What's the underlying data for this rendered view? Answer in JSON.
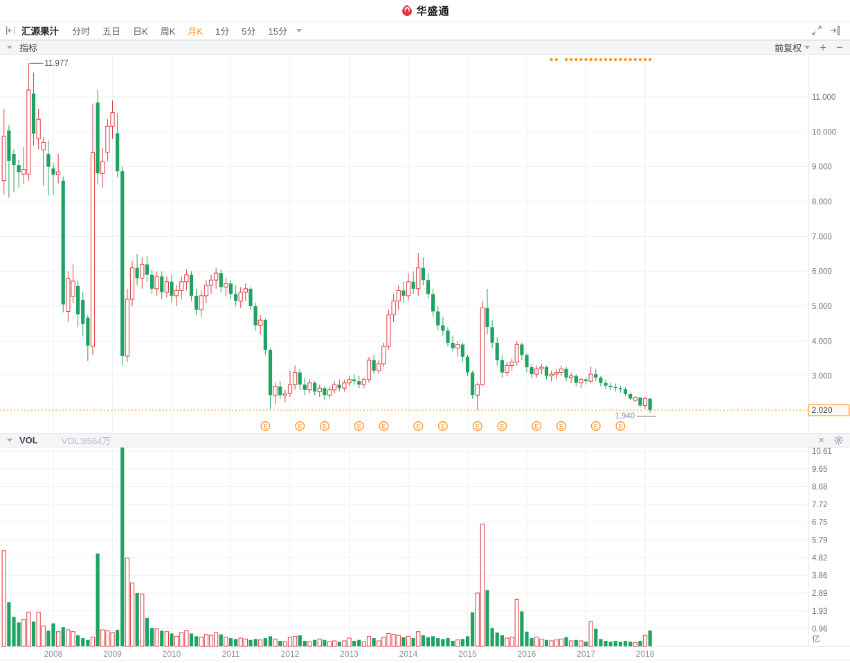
{
  "header": {
    "app_name": "华盛通"
  },
  "toolbar": {
    "stock_name": "汇源果汁",
    "tabs": [
      "分时",
      "五日",
      "日K",
      "周K",
      "月K",
      "1分",
      "5分",
      "15分"
    ],
    "active_tab": "月K"
  },
  "indicator_bar": {
    "label": "指标",
    "adjustment": "前复权",
    "zoom_in": "+",
    "zoom_out": "−"
  },
  "vol_bar": {
    "label": "VOL",
    "value_text": "VOL:8564万"
  },
  "price_axis": {
    "ticks": [
      "11.000",
      "10.000",
      "9.000",
      "8.000",
      "7.000",
      "6.000",
      "5.000",
      "4.000",
      "3.000"
    ],
    "current_price": "2.020"
  },
  "volume_axis": {
    "ticks": [
      "10.61",
      "9.65",
      "8.68",
      "7.72",
      "6.75",
      "5.79",
      "4.82",
      "3.86",
      "2.89",
      "1.93",
      "0.96"
    ],
    "unit": "亿"
  },
  "x_axis": {
    "years": [
      "2008",
      "2009",
      "2010",
      "2011",
      "2012",
      "2013",
      "2014",
      "2015",
      "2016",
      "2017",
      "2018"
    ]
  },
  "annotations": {
    "high": "11.977",
    "low": "1.940"
  },
  "colors": {
    "up": "#e0383e",
    "down": "#1ea362",
    "accent": "#ff8f1f",
    "current_line": "#ff9000",
    "grid": "#eef0f3",
    "axis_line": "#dfe2e6",
    "tick_text": "#6b7078",
    "year_text": "#8a9099"
  },
  "chart_data": {
    "type": "candlestick_with_volume",
    "symbol": "汇源果汁",
    "period": "月K",
    "adjustment": "前复权",
    "price_gridline_values": [
      11,
      10,
      9,
      8,
      7,
      6,
      5,
      4,
      3
    ],
    "current_price": 2.02,
    "high_marker": {
      "month": "2007-08",
      "value": 11.977
    },
    "low_marker": {
      "month": "2018-02",
      "value": 1.94
    },
    "volume_gridline_step": 0.9645,
    "volume_unit": "亿",
    "last_volume_text": "VOL:8564万",
    "earnings_marker_months": [
      "2011-08",
      "2012-03",
      "2012-08",
      "2013-03",
      "2013-08",
      "2014-03",
      "2014-08",
      "2015-03",
      "2015-08",
      "2016-03",
      "2016-08",
      "2017-03",
      "2017-08"
    ],
    "event_dot_months": [
      "2016-06",
      "2016-07",
      "2016-09",
      "2016-10",
      "2016-11",
      "2016-12",
      "2017-01",
      "2017-02",
      "2017-03",
      "2017-04",
      "2017-05",
      "2017-06",
      "2017-07",
      "2017-08",
      "2017-09",
      "2017-10",
      "2017-11",
      "2017-12",
      "2018-01",
      "2018-02"
    ],
    "columns": [
      "month",
      "open",
      "high",
      "low",
      "close",
      "volume_yi"
    ],
    "candles": [
      [
        "2007-03",
        8.6,
        10.66,
        8.2,
        9.87,
        5.2
      ],
      [
        "2007-04",
        10.04,
        10.2,
        8.11,
        9.17,
        2.4
      ],
      [
        "2007-05",
        9.37,
        9.5,
        8.27,
        9.05,
        1.6
      ],
      [
        "2007-06",
        9.05,
        9.2,
        8.4,
        8.85,
        1.3
      ],
      [
        "2007-07",
        8.79,
        9.57,
        8.51,
        8.92,
        1.45
      ],
      [
        "2007-08",
        8.79,
        11.977,
        8.6,
        11.2,
        1.85
      ],
      [
        "2007-09",
        11.1,
        11.7,
        9.6,
        9.95,
        1.35
      ],
      [
        "2007-10",
        9.8,
        10.66,
        9.5,
        10.36,
        1.85
      ],
      [
        "2007-11",
        9.48,
        9.85,
        8.45,
        9.7,
        1.1
      ],
      [
        "2007-12",
        9.37,
        9.75,
        8.17,
        9.0,
        0.85
      ],
      [
        "2008-01",
        8.95,
        9.1,
        8.2,
        8.77,
        1.25
      ],
      [
        "2008-02",
        8.77,
        9.37,
        8.51,
        8.85,
        0.8
      ],
      [
        "2008-03",
        8.6,
        8.72,
        4.82,
        5.05,
        1.05
      ],
      [
        "2008-04",
        4.85,
        6.0,
        4.55,
        5.8,
        0.9
      ],
      [
        "2008-05",
        5.28,
        6.2,
        5.1,
        5.72,
        0.8
      ],
      [
        "2008-06",
        5.58,
        5.75,
        4.4,
        4.77,
        0.6
      ],
      [
        "2008-07",
        5.18,
        5.4,
        4.15,
        4.49,
        0.45
      ],
      [
        "2008-08",
        4.67,
        4.75,
        3.43,
        3.87,
        0.35
      ],
      [
        "2008-09",
        3.85,
        10.8,
        3.6,
        9.4,
        0.5
      ],
      [
        "2008-10",
        10.84,
        11.2,
        8.5,
        8.81,
        5.05
      ],
      [
        "2008-11",
        8.81,
        9.55,
        8.4,
        9.15,
        0.9
      ],
      [
        "2008-12",
        9.41,
        10.36,
        9.15,
        10.16,
        0.85
      ],
      [
        "2009-01",
        10.16,
        10.9,
        9.8,
        10.55,
        0.75
      ],
      [
        "2009-02",
        9.96,
        10.54,
        8.7,
        8.87,
        0.9
      ],
      [
        "2009-03",
        8.87,
        9.0,
        3.3,
        3.57,
        10.8
      ],
      [
        "2009-04",
        3.57,
        5.5,
        3.4,
        5.2,
        4.8
      ],
      [
        "2009-05",
        5.2,
        6.3,
        5.0,
        6.1,
        3.45
      ],
      [
        "2009-06",
        6.1,
        6.5,
        5.6,
        5.8,
        2.9
      ],
      [
        "2009-07",
        5.8,
        6.4,
        5.5,
        6.2,
        2.85
      ],
      [
        "2009-08",
        6.2,
        6.45,
        5.7,
        5.9,
        1.55
      ],
      [
        "2009-09",
        5.9,
        6.05,
        5.35,
        5.5,
        1.0
      ],
      [
        "2009-10",
        5.5,
        6.0,
        5.3,
        5.85,
        0.95
      ],
      [
        "2009-11",
        5.85,
        6.0,
        5.2,
        5.4,
        0.85
      ],
      [
        "2009-12",
        5.4,
        5.85,
        5.25,
        5.7,
        0.8
      ],
      [
        "2010-01",
        5.7,
        5.9,
        5.1,
        5.3,
        0.7
      ],
      [
        "2010-02",
        5.3,
        5.6,
        5.0,
        5.45,
        0.55
      ],
      [
        "2010-03",
        5.45,
        5.85,
        5.2,
        5.7,
        0.75
      ],
      [
        "2010-04",
        5.7,
        6.05,
        5.45,
        5.9,
        0.85
      ],
      [
        "2010-05",
        5.9,
        6.0,
        5.15,
        5.3,
        0.7
      ],
      [
        "2010-06",
        5.3,
        5.5,
        4.75,
        4.9,
        0.55
      ],
      [
        "2010-07",
        4.9,
        5.45,
        4.7,
        5.3,
        0.5
      ],
      [
        "2010-08",
        5.3,
        5.75,
        5.1,
        5.6,
        0.65
      ],
      [
        "2010-09",
        5.6,
        5.9,
        5.35,
        5.75,
        0.6
      ],
      [
        "2010-10",
        5.75,
        6.1,
        5.5,
        5.95,
        0.75
      ],
      [
        "2010-11",
        5.95,
        6.05,
        5.4,
        5.55,
        0.65
      ],
      [
        "2010-12",
        5.55,
        5.8,
        5.3,
        5.65,
        0.5
      ],
      [
        "2011-01",
        5.65,
        5.75,
        5.2,
        5.35,
        0.45
      ],
      [
        "2011-02",
        5.35,
        5.6,
        5.0,
        5.15,
        0.4
      ],
      [
        "2011-03",
        5.15,
        5.55,
        4.95,
        5.4,
        0.45
      ],
      [
        "2011-04",
        5.4,
        5.65,
        5.15,
        5.5,
        0.4
      ],
      [
        "2011-05",
        5.5,
        5.55,
        4.9,
        5.0,
        0.35
      ],
      [
        "2011-06",
        5.0,
        5.1,
        4.3,
        4.45,
        0.4
      ],
      [
        "2011-07",
        4.45,
        4.75,
        4.2,
        4.6,
        0.35
      ],
      [
        "2011-08",
        4.6,
        4.65,
        3.6,
        3.75,
        0.45
      ],
      [
        "2011-09",
        3.75,
        3.8,
        2.05,
        2.45,
        0.55
      ],
      [
        "2011-10",
        2.45,
        2.8,
        2.2,
        2.7,
        0.4
      ],
      [
        "2011-11",
        2.7,
        2.85,
        2.35,
        2.45,
        0.3
      ],
      [
        "2011-12",
        2.45,
        2.6,
        2.25,
        2.5,
        0.25
      ],
      [
        "2012-01",
        2.5,
        3.15,
        2.4,
        2.75,
        0.5
      ],
      [
        "2012-02",
        2.75,
        3.3,
        2.6,
        3.1,
        0.55
      ],
      [
        "2012-03",
        3.1,
        3.2,
        2.6,
        2.75,
        0.6
      ],
      [
        "2012-04",
        2.75,
        2.95,
        2.45,
        2.6,
        0.3
      ],
      [
        "2012-05",
        2.6,
        2.9,
        2.5,
        2.8,
        0.25
      ],
      [
        "2012-06",
        2.8,
        2.85,
        2.45,
        2.55,
        0.35
      ],
      [
        "2012-07",
        2.55,
        2.75,
        2.4,
        2.65,
        0.4
      ],
      [
        "2012-08",
        2.65,
        2.7,
        2.3,
        2.45,
        0.35
      ],
      [
        "2012-09",
        2.45,
        2.7,
        2.35,
        2.6,
        0.25
      ],
      [
        "2012-10",
        2.6,
        2.85,
        2.5,
        2.75,
        0.3
      ],
      [
        "2012-11",
        2.75,
        2.9,
        2.55,
        2.65,
        0.25
      ],
      [
        "2012-12",
        2.65,
        2.9,
        2.55,
        2.8,
        0.3
      ],
      [
        "2013-01",
        2.8,
        3.0,
        2.7,
        2.9,
        0.45
      ],
      [
        "2013-02",
        2.9,
        3.05,
        2.75,
        2.85,
        0.3
      ],
      [
        "2013-03",
        2.85,
        3.0,
        2.65,
        2.75,
        0.35
      ],
      [
        "2013-04",
        2.75,
        2.95,
        2.65,
        2.9,
        0.25
      ],
      [
        "2013-05",
        2.9,
        3.55,
        2.8,
        3.45,
        0.55
      ],
      [
        "2013-06",
        3.45,
        3.6,
        3.05,
        3.15,
        0.45
      ],
      [
        "2013-07",
        3.15,
        3.45,
        3.05,
        3.35,
        0.3
      ],
      [
        "2013-08",
        3.35,
        3.95,
        3.25,
        3.85,
        0.5
      ],
      [
        "2013-09",
        3.85,
        4.9,
        3.75,
        4.75,
        0.7
      ],
      [
        "2013-10",
        4.75,
        5.35,
        4.55,
        5.15,
        0.65
      ],
      [
        "2013-11",
        5.15,
        5.6,
        4.9,
        5.45,
        0.6
      ],
      [
        "2013-12",
        5.45,
        5.7,
        5.1,
        5.3,
        0.5
      ],
      [
        "2014-01",
        5.3,
        5.95,
        5.15,
        5.7,
        0.55
      ],
      [
        "2014-02",
        5.7,
        6.0,
        5.35,
        5.5,
        0.45
      ],
      [
        "2014-03",
        5.5,
        6.53,
        5.3,
        6.1,
        0.8
      ],
      [
        "2014-04",
        6.1,
        6.4,
        5.6,
        5.75,
        0.6
      ],
      [
        "2014-05",
        5.75,
        5.95,
        5.2,
        5.35,
        0.5
      ],
      [
        "2014-06",
        5.35,
        5.5,
        4.7,
        4.85,
        0.55
      ],
      [
        "2014-07",
        4.85,
        5.0,
        4.3,
        4.45,
        0.45
      ],
      [
        "2014-08",
        4.45,
        4.7,
        4.15,
        4.3,
        0.4
      ],
      [
        "2014-09",
        4.3,
        4.4,
        3.85,
        3.95,
        0.45
      ],
      [
        "2014-10",
        3.95,
        4.15,
        3.7,
        3.8,
        0.3
      ],
      [
        "2014-11",
        3.8,
        4.0,
        3.55,
        3.9,
        0.35
      ],
      [
        "2014-12",
        3.9,
        3.95,
        3.4,
        3.55,
        0.4
      ],
      [
        "2015-01",
        3.55,
        3.6,
        3.0,
        3.1,
        0.55
      ],
      [
        "2015-02",
        3.1,
        3.15,
        2.35,
        2.45,
        1.85
      ],
      [
        "2015-03",
        2.45,
        2.8,
        2.02,
        2.75,
        2.9
      ],
      [
        "2015-04",
        2.75,
        5.15,
        2.7,
        4.95,
        6.65
      ],
      [
        "2015-05",
        4.95,
        5.5,
        4.2,
        4.4,
        3.05
      ],
      [
        "2015-06",
        4.4,
        4.6,
        3.8,
        3.95,
        1.0
      ],
      [
        "2015-07",
        3.95,
        4.1,
        3.3,
        3.45,
        0.75
      ],
      [
        "2015-08",
        3.45,
        3.6,
        2.95,
        3.1,
        0.6
      ],
      [
        "2015-09",
        3.1,
        3.4,
        3.0,
        3.3,
        0.45
      ],
      [
        "2015-10",
        3.3,
        3.5,
        3.15,
        3.4,
        0.5
      ],
      [
        "2015-11",
        3.4,
        4.0,
        3.3,
        3.9,
        2.55
      ],
      [
        "2015-12",
        3.9,
        3.95,
        3.45,
        3.6,
        1.9
      ],
      [
        "2016-01",
        3.6,
        3.65,
        3.1,
        3.25,
        0.8
      ],
      [
        "2016-02",
        3.25,
        3.35,
        2.95,
        3.05,
        0.45
      ],
      [
        "2016-03",
        3.05,
        3.3,
        2.95,
        3.2,
        0.5
      ],
      [
        "2016-04",
        3.2,
        3.35,
        3.05,
        3.25,
        0.4
      ],
      [
        "2016-05",
        3.25,
        3.3,
        2.9,
        3.0,
        0.35
      ],
      [
        "2016-06",
        3.0,
        3.15,
        2.85,
        3.05,
        0.3
      ],
      [
        "2016-07",
        3.05,
        3.2,
        2.9,
        3.1,
        0.35
      ],
      [
        "2016-08",
        3.1,
        3.3,
        3.0,
        3.2,
        0.4
      ],
      [
        "2016-09",
        3.2,
        3.25,
        2.85,
        2.95,
        0.5
      ],
      [
        "2016-10",
        2.95,
        3.1,
        2.8,
        3.0,
        0.3
      ],
      [
        "2016-11",
        3.0,
        3.05,
        2.7,
        2.8,
        0.35
      ],
      [
        "2016-12",
        2.8,
        2.95,
        2.65,
        2.9,
        0.3
      ],
      [
        "2017-01",
        2.9,
        2.95,
        2.75,
        2.85,
        0.25
      ],
      [
        "2017-02",
        2.85,
        3.27,
        2.8,
        3.05,
        1.35
      ],
      [
        "2017-03",
        3.05,
        3.2,
        2.85,
        2.95,
        0.95
      ],
      [
        "2017-04",
        2.95,
        3.0,
        2.7,
        2.8,
        0.4
      ],
      [
        "2017-05",
        2.8,
        2.9,
        2.62,
        2.72,
        0.3
      ],
      [
        "2017-06",
        2.72,
        2.82,
        2.58,
        2.68,
        0.25
      ],
      [
        "2017-07",
        2.68,
        2.78,
        2.55,
        2.65,
        0.3
      ],
      [
        "2017-08",
        2.65,
        2.72,
        2.52,
        2.62,
        0.25
      ],
      [
        "2017-09",
        2.62,
        2.68,
        2.42,
        2.48,
        0.3
      ],
      [
        "2017-10",
        2.48,
        2.52,
        2.3,
        2.35,
        0.25
      ],
      [
        "2017-11",
        2.3,
        2.42,
        2.25,
        2.38,
        0.2
      ],
      [
        "2017-12",
        2.38,
        2.4,
        2.1,
        2.15,
        0.3
      ],
      [
        "2018-01",
        2.15,
        2.4,
        2.06,
        2.35,
        0.6
      ],
      [
        "2018-02",
        2.35,
        2.36,
        1.94,
        2.02,
        0.86
      ]
    ]
  }
}
